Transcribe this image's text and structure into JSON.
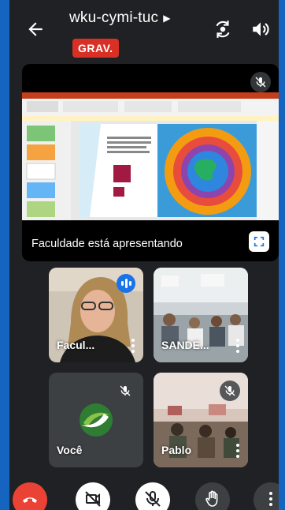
{
  "meeting": {
    "code": "wku-cymi-tuc",
    "recording_badge": "GRAV."
  },
  "presentation": {
    "caption": "Faculdade está apresentando",
    "mic_muted": true
  },
  "participants": [
    {
      "name": "Facul...",
      "speaking": true,
      "mic_muted": false
    },
    {
      "name": "SANDE...",
      "speaking": false,
      "mic_muted": false
    },
    {
      "name": "Você",
      "speaking": false,
      "mic_muted": true
    },
    {
      "name": "Pablo",
      "speaking": false,
      "mic_muted": true
    }
  ],
  "controls": [
    "end-call",
    "camera-off",
    "mic-off",
    "raise-hand",
    "more-options"
  ],
  "colors": {
    "background": "#202124",
    "frame": "#1565c0",
    "record": "#d93025",
    "speaking": "#1a73e8",
    "end_call": "#ea4335"
  }
}
